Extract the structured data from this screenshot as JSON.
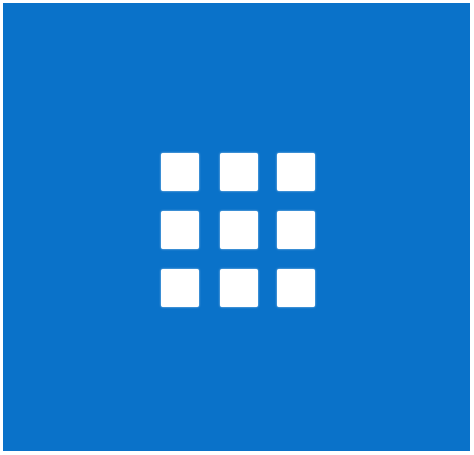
{
  "tile": {
    "icon": "app-launcher-grid-icon",
    "background_color": "#0a72c9",
    "icon_color": "#ffffff",
    "grid": {
      "rows": 3,
      "columns": 3
    }
  }
}
